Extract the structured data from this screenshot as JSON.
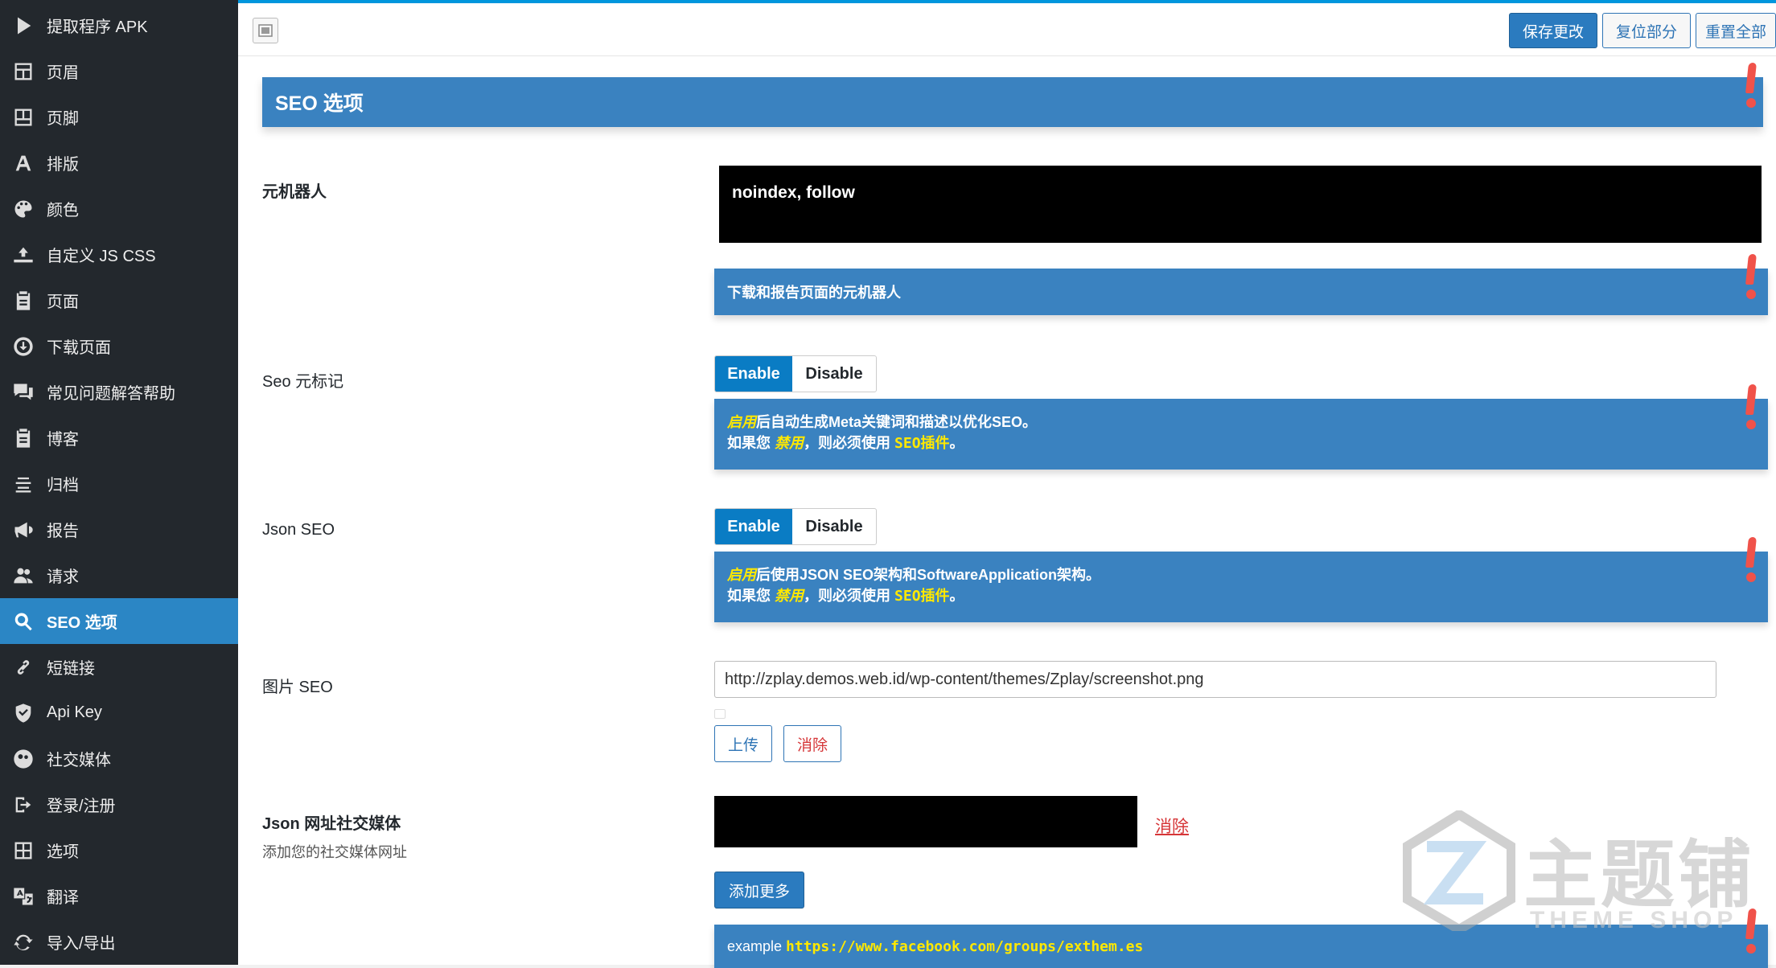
{
  "sidebar": {
    "items": [
      {
        "label": "提取程序 APK",
        "icon": "play-icon"
      },
      {
        "label": "页眉",
        "icon": "layout-icon"
      },
      {
        "label": "页脚",
        "icon": "layout-icon"
      },
      {
        "label": "排版",
        "icon": "font-icon"
      },
      {
        "label": "颜色",
        "icon": "palette-icon"
      },
      {
        "label": "自定义 JS CSS",
        "icon": "html-icon"
      },
      {
        "label": "页面",
        "icon": "clipboard-icon"
      },
      {
        "label": "下载页面",
        "icon": "download-icon"
      },
      {
        "label": "常见问题解答帮助",
        "icon": "comments-icon"
      },
      {
        "label": "博客",
        "icon": "clipboard-icon"
      },
      {
        "label": "归档",
        "icon": "align-icon"
      },
      {
        "label": "报告",
        "icon": "megaphone-icon"
      },
      {
        "label": "请求",
        "icon": "users-icon"
      },
      {
        "label": "SEO 选项",
        "icon": "search-icon"
      },
      {
        "label": "短链接",
        "icon": "link-icon"
      },
      {
        "label": "Api Key",
        "icon": "shield-icon"
      },
      {
        "label": "社交媒体",
        "icon": "people-icon"
      },
      {
        "label": "登录/注册",
        "icon": "exit-icon"
      },
      {
        "label": "选项",
        "icon": "grid-icon"
      },
      {
        "label": "翻译",
        "icon": "translate-icon"
      },
      {
        "label": "导入/导出",
        "icon": "refresh-icon"
      }
    ],
    "active_index": 13
  },
  "toolbar": {
    "save_label": "保存更改",
    "reset_section_label": "复位部分",
    "reset_all_label": "重置全部"
  },
  "section": {
    "title": "SEO 选项"
  },
  "fields": {
    "robots": {
      "label": "元机器人",
      "value": "noindex, follow",
      "info": "下载和报告页面的元机器人"
    },
    "seo_meta": {
      "label": "Seo 元标记",
      "enable_label": "Enable",
      "disable_label": "Disable",
      "info_line1_highlight": "启用",
      "info_line1_rest": "后自动生成Meta关键词和描述以优化SEO。",
      "info_line2_prefix": "如果您 ",
      "info_line2_highlight": "禁用",
      "info_line2_mid": "，则必须使用 ",
      "info_line2_plugin": "SEO插件",
      "info_line2_suffix": "。"
    },
    "json_seo": {
      "label": "Json SEO",
      "enable_label": "Enable",
      "disable_label": "Disable",
      "info_line1_highlight": "启用",
      "info_line1_rest": "后使用JSON SEO架构和SoftwareApplication架构。",
      "info_line2_prefix": "如果您 ",
      "info_line2_highlight": "禁用",
      "info_line2_mid": "，则必须使用 ",
      "info_line2_plugin": "SEO插件",
      "info_line2_suffix": "。"
    },
    "image_seo": {
      "label": "图片 SEO",
      "url": "http://zplay.demos.web.id/wp-content/themes/Zplay/screenshot.png",
      "upload_label": "上传",
      "remove_label": "消除"
    },
    "json_social": {
      "label": "Json 网址社交媒体",
      "sublabel": "添加您的社交媒体网址",
      "remove_label": "消除",
      "add_more_label": "添加更多",
      "example_prefix": "example ",
      "example_url": "https://www.facebook.com/groups/exthem.es"
    }
  },
  "watermark": {
    "big_text": "主题铺",
    "small_text": "THEME SHOP"
  },
  "colors": {
    "sidebar_bg": "#23282d",
    "active_item": "#2b86c5",
    "info_blue": "#3a82c0",
    "highlight_yellow": "#ffe800",
    "warning_red": "#f0524a"
  }
}
